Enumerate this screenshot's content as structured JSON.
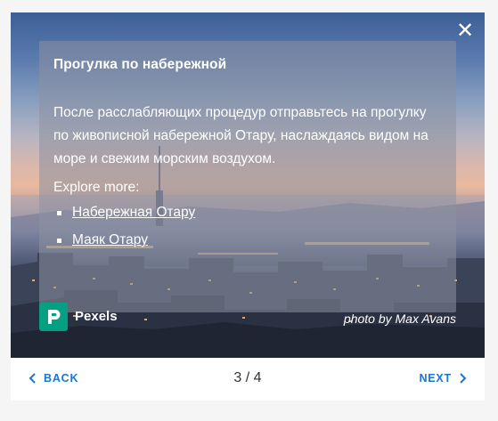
{
  "modal": {
    "close_icon": "close-icon",
    "card": {
      "title": "Прогулка по набережной",
      "description": "После расслабляющих процедур отправьтесь на прогулку по живописной набережной Отару, наслаждаясь видом на море и свежим морским воздухом.",
      "explore_label": "Explore more:",
      "links": [
        {
          "label": "Набережная Отару"
        },
        {
          "label": "Маяк Отару"
        }
      ]
    },
    "attribution": {
      "brand": "Pexels",
      "brand_icon": "pexels-logo-icon",
      "brand_color": "#05a081",
      "credit": "photo by Max Avans"
    },
    "footer": {
      "back_label": "BACK",
      "next_label": "NEXT",
      "page_indicator": "3 / 4",
      "accent_color": "#1976d2"
    }
  }
}
